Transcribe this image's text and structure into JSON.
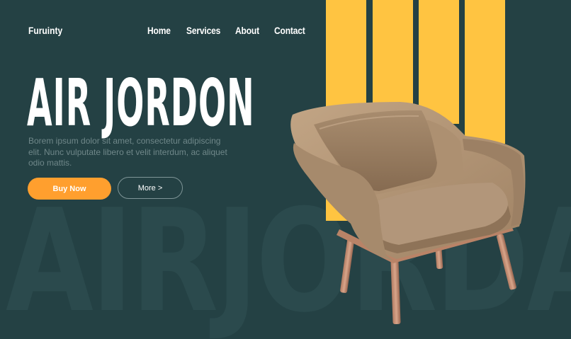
{
  "header": {
    "brand": "Furuinty",
    "nav": [
      "Home",
      "Services",
      "About",
      "Contact"
    ]
  },
  "hero": {
    "title": "AIR JORDON",
    "description": "Borem ipsum dolor sit amet, consectetur adipiscing elit. Nunc vulputate libero et velit interdum, ac aliquet odio mattis.",
    "buy_label": "Buy Now",
    "more_label": "More >",
    "watermark": "AIRJORDAN"
  },
  "colors": {
    "background": "#244144",
    "accent_yellow": "#ffc441",
    "button_orange": "#ff9f2e"
  }
}
